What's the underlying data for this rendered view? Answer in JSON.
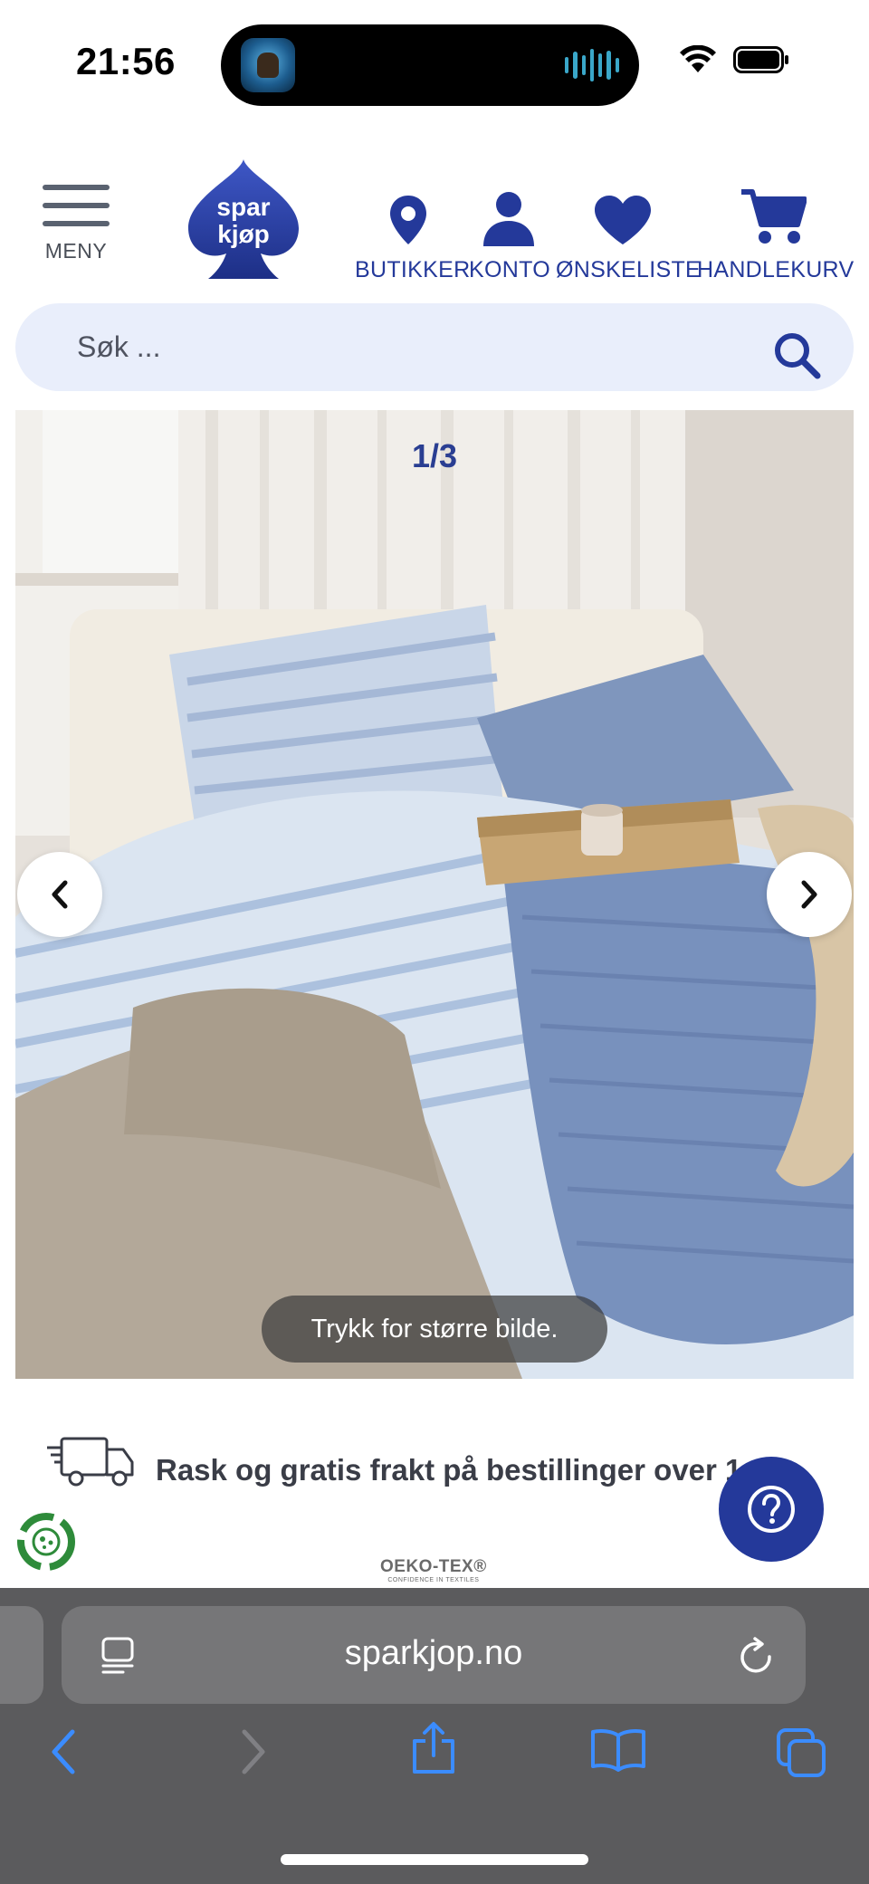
{
  "status_bar": {
    "time": "21:56"
  },
  "header": {
    "menu_label": "MENY",
    "logo_text_top": "spar",
    "logo_text_bottom": "kjøp",
    "nav": {
      "stores": "BUTIKKER",
      "account": "KONTO",
      "wishlist": "ØNSKELISTE",
      "cart": "HANDLEKURV"
    }
  },
  "search": {
    "placeholder": "Søk ..."
  },
  "gallery": {
    "counter": "1/3",
    "zoom_hint": "Trykk for større bilde."
  },
  "shipping": {
    "text": "Rask og gratis frakt på bestillinger over 1..."
  },
  "certification": {
    "title": "OEKO-TEX®",
    "subtitle": "CONFIDENCE IN TEXTILES"
  },
  "browser": {
    "url": "sparkjop.no"
  },
  "colors": {
    "brand_blue": "#24399a",
    "search_bg": "#e9eefb",
    "browser_bg": "#5b5b5d",
    "browser_accent": "#3b8cff"
  },
  "icons": [
    "location-pin-icon",
    "person-icon",
    "heart-icon",
    "cart-icon",
    "search-icon",
    "chevron-left-icon",
    "chevron-right-icon",
    "truck-icon",
    "help-icon",
    "recycle-icon",
    "reader-icon",
    "reload-icon",
    "back-icon",
    "forward-icon",
    "share-icon",
    "bookmarks-icon",
    "tabs-icon"
  ]
}
